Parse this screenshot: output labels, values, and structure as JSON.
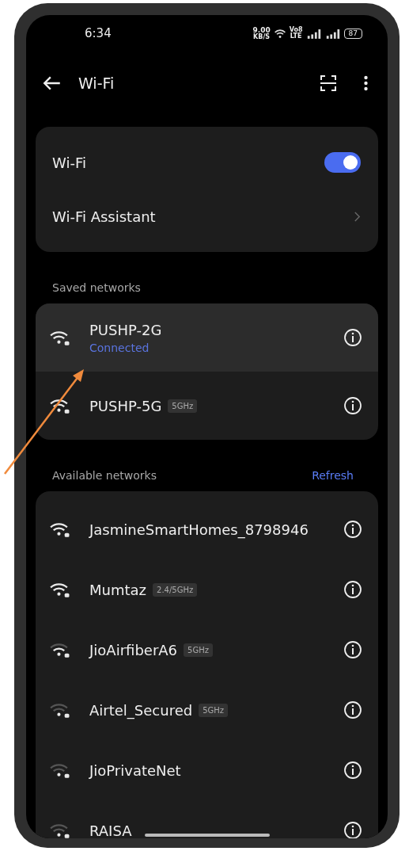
{
  "status_bar": {
    "time": "6:34",
    "speed": "9.00",
    "speed_unit": "KB/S",
    "volte_top": "Vo8",
    "volte_bottom": "LTE",
    "battery": "87"
  },
  "toolbar": {
    "title": "Wi-Fi"
  },
  "settings": [
    {
      "kind": "toggle",
      "label": "Wi-Fi",
      "on": true
    },
    {
      "kind": "link",
      "label": "Wi-Fi Assistant"
    }
  ],
  "saved_networks": {
    "heading": "Saved networks",
    "items": [
      {
        "name": "PUSHP-2G",
        "status": "Connected",
        "kind": "strong",
        "selected": true
      },
      {
        "name": "PUSHP-5G",
        "band": "5GHz",
        "kind": "strong",
        "selected": false
      }
    ]
  },
  "available_networks": {
    "heading": "Available networks",
    "refresh": "Refresh",
    "items": [
      {
        "name": "JasmineSmartHomes_8798946",
        "kind": "strong"
      },
      {
        "name": "Mumtaz",
        "band": "2.4/5GHz",
        "kind": "strong"
      },
      {
        "name": "JioAirfiberA6",
        "band": "5GHz",
        "kind": "medium"
      },
      {
        "name": "Airtel_Secured",
        "band": "5GHz",
        "kind": "weak"
      },
      {
        "name": "JioPrivateNet",
        "kind": "weak"
      },
      {
        "name": "RAISA",
        "kind": "weak"
      }
    ]
  }
}
